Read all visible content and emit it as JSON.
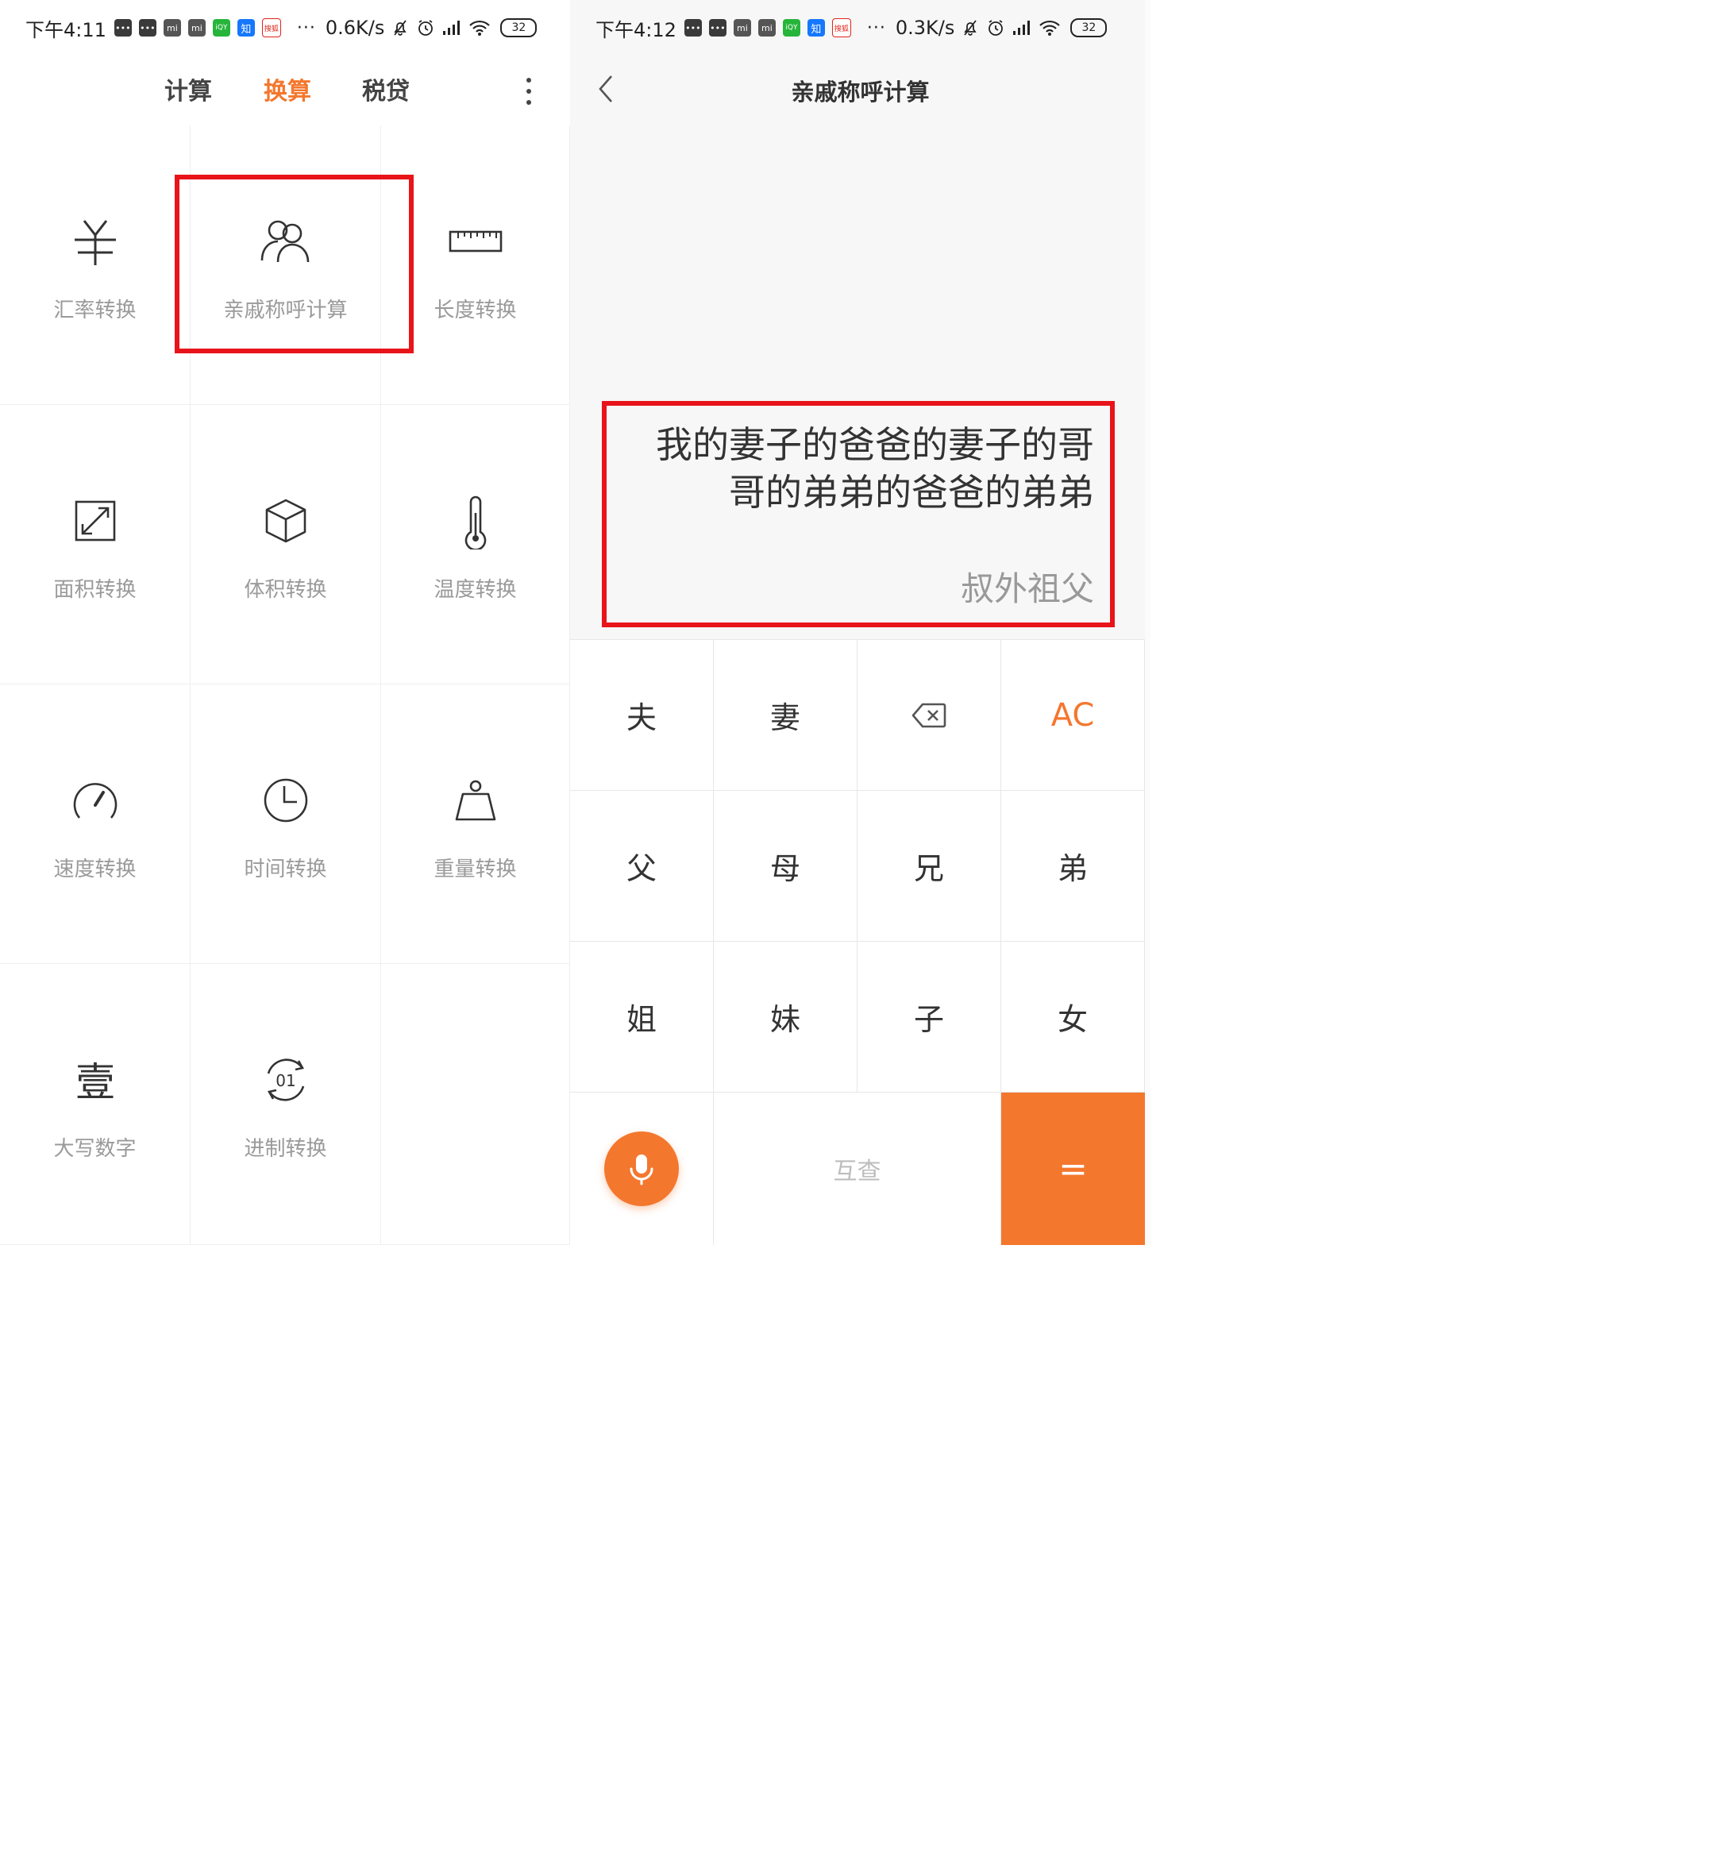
{
  "left": {
    "status": {
      "time": "下午4:11",
      "speed": "0.6K/s",
      "battery": "32"
    },
    "tabs": [
      "计算",
      "换算",
      "税贷"
    ],
    "active_tab": "换算",
    "tools": [
      {
        "label": "汇率转换",
        "icon": "yen-icon"
      },
      {
        "label": "亲戚称呼计算",
        "icon": "people-icon"
      },
      {
        "label": "长度转换",
        "icon": "ruler-icon"
      },
      {
        "label": "面积转换",
        "icon": "area-icon"
      },
      {
        "label": "体积转换",
        "icon": "cube-icon"
      },
      {
        "label": "温度转换",
        "icon": "thermometer-icon"
      },
      {
        "label": "速度转换",
        "icon": "speedometer-icon"
      },
      {
        "label": "时间转换",
        "icon": "clock-icon"
      },
      {
        "label": "重量转换",
        "icon": "weight-icon"
      },
      {
        "label": "大写数字",
        "icon": "chinese-numeral-icon"
      },
      {
        "label": "进制转换",
        "icon": "base-convert-icon"
      }
    ]
  },
  "right": {
    "status": {
      "time": "下午4:12",
      "speed": "0.3K/s",
      "battery": "32"
    },
    "title": "亲戚称呼计算",
    "expression_line1": "我的妻子的爸爸的妻子的哥",
    "expression_line2": "哥的弟弟的爸爸的弟弟",
    "result": "叔外祖父",
    "keys": {
      "husband": "夫",
      "wife": "妻",
      "clear": "AC",
      "father": "父",
      "mother": "母",
      "elder_brother": "兄",
      "younger_brother": "弟",
      "elder_sister": "姐",
      "younger_sister": "妹",
      "son": "子",
      "daughter": "女",
      "mutual": "互查",
      "equals": "="
    }
  },
  "colors": {
    "accent": "#f4772e",
    "highlight": "#e8141a"
  }
}
